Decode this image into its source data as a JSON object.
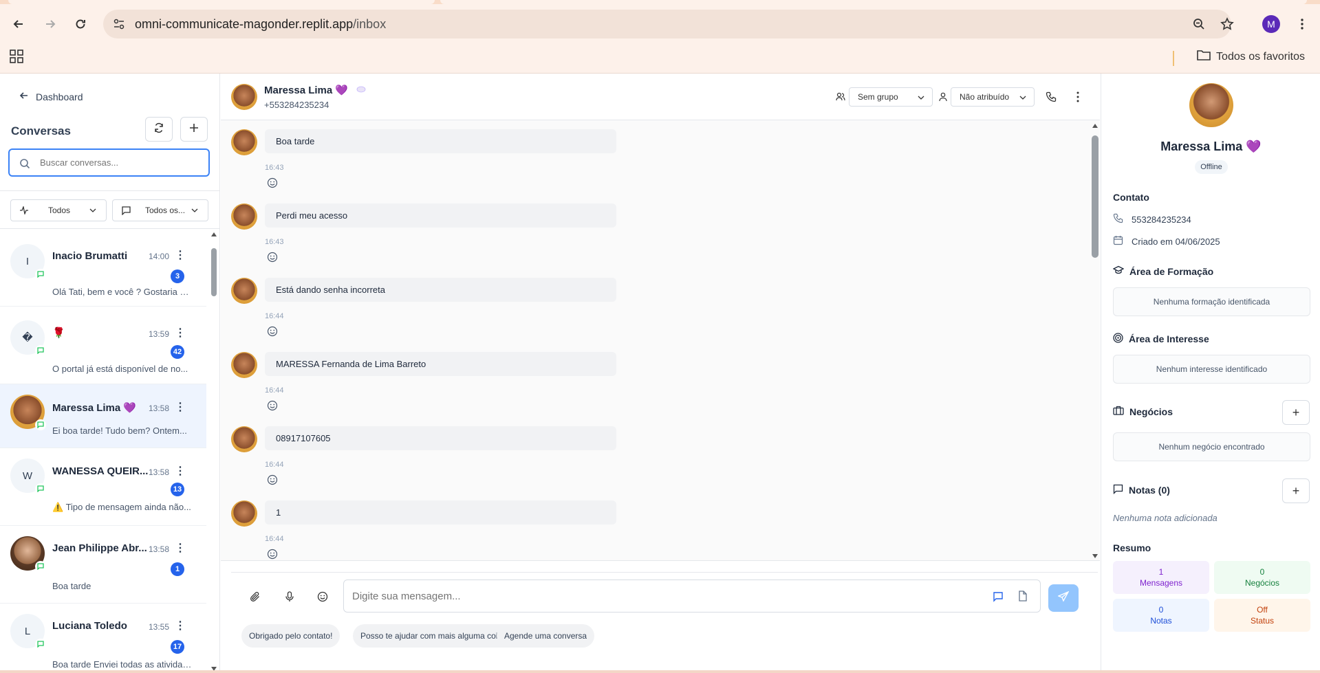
{
  "browser": {
    "url_domain": "omni-communicate-magonder.replit.app",
    "url_path": "/inbox",
    "profile_initial": "M",
    "bookmarks_label": "Todos os favoritos"
  },
  "sidebar": {
    "back_label": "Dashboard",
    "title": "Conversas",
    "search_placeholder": "Buscar conversas...",
    "filter_status": "Todos",
    "filter_channel": "Todos os...",
    "conversations": [
      {
        "initial": "I",
        "name": "Inacio Brumatti",
        "time": "14:00",
        "badge": "3",
        "preview": "Olá Tati, bem e você ? Gostaria de..."
      },
      {
        "initial": "�",
        "name": "🌹",
        "time": "13:59",
        "badge": "42",
        "preview": "O portal já está disponível de no..."
      },
      {
        "initial": "",
        "name": "Maressa Lima 💜",
        "time": "13:58",
        "badge": "",
        "preview": "Ei boa tarde! Tudo bem? Ontem..."
      },
      {
        "initial": "W",
        "name": "WANESSA QUEIR...",
        "time": "13:58",
        "badge": "13",
        "preview": "⚠️ Tipo de mensagem ainda não..."
      },
      {
        "initial": "",
        "name": "Jean Philippe Abr...",
        "time": "13:58",
        "badge": "1",
        "preview": "Boa tarde"
      },
      {
        "initial": "L",
        "name": "Luciana Toledo",
        "time": "13:55",
        "badge": "17",
        "preview": "Boa tarde Enviei todas as atividades"
      }
    ]
  },
  "chat": {
    "contact_name": "Maressa Lima 💜",
    "contact_phone": "+553284235234",
    "group_select": "Sem grupo",
    "assign_select": "Não atribuído",
    "messages": [
      {
        "text": "Boa tarde",
        "time": "16:43"
      },
      {
        "text": "Perdi meu acesso",
        "time": "16:43"
      },
      {
        "text": "Está dando senha incorreta",
        "time": "16:44"
      },
      {
        "text": "MARESSA Fernanda de Lima Barreto",
        "time": "16:44"
      },
      {
        "text": "08917107605",
        "time": "16:44"
      },
      {
        "text": "1",
        "time": "16:44"
      }
    ],
    "composer_placeholder": "Digite sua mensagem...",
    "quick_replies": [
      "Obrigado pelo contato!",
      "Posso te ajudar com mais alguma coisa?",
      "Agende uma conversa"
    ]
  },
  "profile": {
    "name": "Maressa Lima 💜",
    "status": "Offline",
    "contact_title": "Contato",
    "phone": "553284235234",
    "created": "Criado em 04/06/2025",
    "formacao_title": "Área de Formação",
    "formacao_empty": "Nenhuma formação identificada",
    "interesse_title": "Área de Interesse",
    "interesse_empty": "Nenhum interesse identificado",
    "negocios_title": "Negócios",
    "negocios_empty": "Nenhum negócio encontrado",
    "notas_title": "Notas (0)",
    "notas_empty": "Nenhuma nota adicionada",
    "resumo_title": "Resumo",
    "stats": [
      {
        "value": "1",
        "label": "Mensagens",
        "color": "#7e22ce",
        "bg": "#f5f0fd"
      },
      {
        "value": "0",
        "label": "Negócios",
        "color": "#15803d",
        "bg": "#effbf2"
      },
      {
        "value": "0",
        "label": "Notas",
        "color": "#1d4ed8",
        "bg": "#eff5ff"
      },
      {
        "value": "Off",
        "label": "Status",
        "color": "#c2410c",
        "bg": "#fff5ea"
      }
    ]
  }
}
